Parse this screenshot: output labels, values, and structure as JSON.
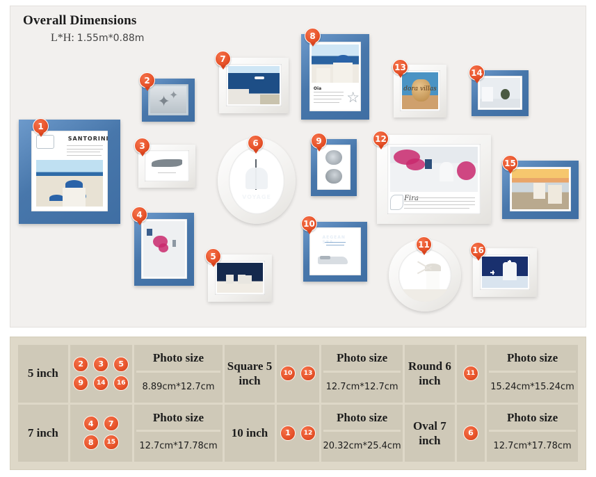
{
  "header": {
    "title": "Overall Dimensions",
    "label": "L*H:",
    "dimensions": "1.55m*0.88m"
  },
  "collage": {
    "frames": [
      {
        "id": "1",
        "number": "1",
        "style": "blue",
        "shape": "rect",
        "orientation": "portrait",
        "caption": "SANTORINI",
        "scene": "santorini-village"
      },
      {
        "id": "2",
        "number": "2",
        "style": "blue",
        "shape": "rect",
        "orientation": "landscape",
        "caption": "",
        "scene": "starfish"
      },
      {
        "id": "3",
        "number": "3",
        "style": "white",
        "shape": "rect",
        "orientation": "landscape",
        "caption": "",
        "scene": "shark"
      },
      {
        "id": "4",
        "number": "4",
        "style": "blue",
        "shape": "rect",
        "orientation": "portrait",
        "caption": "",
        "scene": "bougainvillea-stairs"
      },
      {
        "id": "5",
        "number": "5",
        "style": "white",
        "shape": "rect",
        "orientation": "landscape",
        "caption": "",
        "scene": "night-chairs"
      },
      {
        "id": "6",
        "number": "6",
        "style": "white",
        "shape": "oval",
        "orientation": "portrait",
        "caption": "VOYAGE",
        "scene": "sailing-ship"
      },
      {
        "id": "7",
        "number": "7",
        "style": "white",
        "shape": "rect",
        "orientation": "landscape",
        "caption": "",
        "scene": "sea-cruise-ship"
      },
      {
        "id": "8",
        "number": "8",
        "style": "blue",
        "shape": "rect",
        "orientation": "portrait",
        "caption": "Oia",
        "scene": "blue-dome-church"
      },
      {
        "id": "9",
        "number": "9",
        "style": "blue",
        "shape": "rect",
        "orientation": "portrait",
        "caption": "",
        "scene": "two-shells"
      },
      {
        "id": "10",
        "number": "10",
        "style": "blue",
        "shape": "rect",
        "orientation": "square",
        "caption": "AEGEAN SEA",
        "scene": "motorboat"
      },
      {
        "id": "11",
        "number": "11",
        "style": "white",
        "shape": "round",
        "orientation": "square",
        "caption": "",
        "scene": "windmill"
      },
      {
        "id": "12",
        "number": "12",
        "style": "white",
        "shape": "rect",
        "orientation": "landscape",
        "caption": "Fira",
        "scene": "bougainvillea-house"
      },
      {
        "id": "13",
        "number": "13",
        "style": "white",
        "shape": "rect",
        "orientation": "square",
        "caption": "dora villas",
        "scene": "golden-pot"
      },
      {
        "id": "14",
        "number": "14",
        "style": "blue",
        "shape": "rect",
        "orientation": "landscape",
        "caption": "",
        "scene": "white-terrace"
      },
      {
        "id": "15",
        "number": "15",
        "style": "blue",
        "shape": "rect",
        "orientation": "landscape",
        "caption": "",
        "scene": "sunset-village"
      },
      {
        "id": "16",
        "number": "16",
        "style": "white",
        "shape": "rect",
        "orientation": "landscape",
        "caption": "",
        "scene": "bell-tower"
      }
    ]
  },
  "spec_table": {
    "photo_size_header": "Photo size",
    "rows": [
      {
        "groups": [
          {
            "label": "5 inch",
            "badges": [
              "2",
              "3",
              "5",
              "9",
              "14",
              "16"
            ],
            "header": "Photo size",
            "value": "8.89cm*12.7cm"
          },
          {
            "label": "Square\n5 inch",
            "badges": [
              "10",
              "13"
            ],
            "header": "Photo size",
            "value": "12.7cm*12.7cm"
          },
          {
            "label": "Round\n6 inch",
            "badges": [
              "11"
            ],
            "header": "Photo size",
            "value": "15.24cm*15.24cm"
          }
        ]
      },
      {
        "groups": [
          {
            "label": "7 inch",
            "badges": [
              "4",
              "7",
              "8",
              "15"
            ],
            "header": "Photo size",
            "value": "12.7cm*17.78cm"
          },
          {
            "label": "10 inch",
            "badges": [
              "1",
              "12"
            ],
            "header": "Photo size",
            "value": "20.32cm*25.4cm"
          },
          {
            "label": "Oval\n7 inch",
            "badges": [
              "6"
            ],
            "header": "Photo size",
            "value": "12.7cm*17.78cm"
          }
        ]
      }
    ],
    "labels": {
      "r1c1": "5 inch",
      "r1c2": "Square 5 inch",
      "r1c3": "Round 6 inch",
      "r2c1": "7 inch",
      "r2c2": "10 inch",
      "r2c3": "Oval 7 inch"
    }
  },
  "colors": {
    "badge": "#e8552c",
    "frame_blue": "#4877ab",
    "panel_bg": "#f2f0ee",
    "table_bg": "#cfc9b8",
    "table_border": "#ded8c8"
  }
}
